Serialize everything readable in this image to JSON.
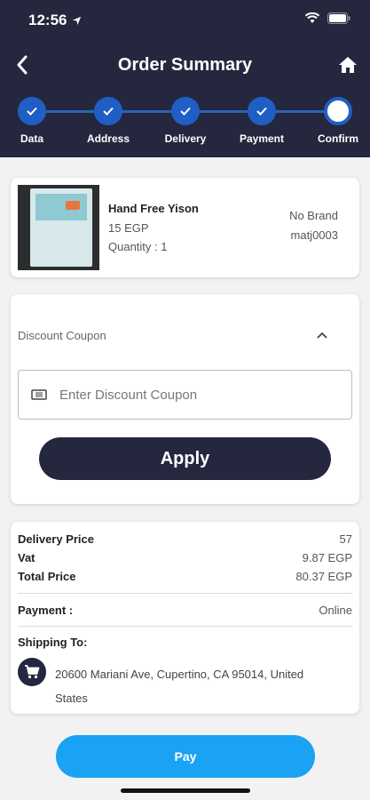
{
  "status_bar": {
    "time": "12:56"
  },
  "header": {
    "title": "Order Summary"
  },
  "stepper": {
    "steps": [
      {
        "label": "Data",
        "state": "done"
      },
      {
        "label": "Address",
        "state": "done"
      },
      {
        "label": "Delivery",
        "state": "done"
      },
      {
        "label": "Payment",
        "state": "done"
      },
      {
        "label": "Confirm",
        "state": "current"
      }
    ]
  },
  "product": {
    "name": "Hand Free Yison",
    "price": "15 EGP",
    "quantity": "Quantity : 1",
    "brand": "No Brand",
    "code": "matj0003"
  },
  "coupon": {
    "title": "Discount Coupon",
    "placeholder": "Enter Discount Coupon",
    "apply_label": "Apply"
  },
  "summary": {
    "delivery_label": "Delivery Price",
    "delivery_value": "57",
    "vat_label": "Vat",
    "vat_value": "9.87 EGP",
    "total_label": "Total Price",
    "total_value": "80.37 EGP",
    "payment_label": "Payment :",
    "payment_value": "Online",
    "shipping_label": "Shipping To:",
    "shipping_address": "20600 Mariani Ave, Cupertino, CA  95014, United States"
  },
  "pay_label": "Pay",
  "colors": {
    "header_bg": "#25273e",
    "step_blue": "#1f5ec4",
    "pay_blue": "#1aa2f4"
  }
}
